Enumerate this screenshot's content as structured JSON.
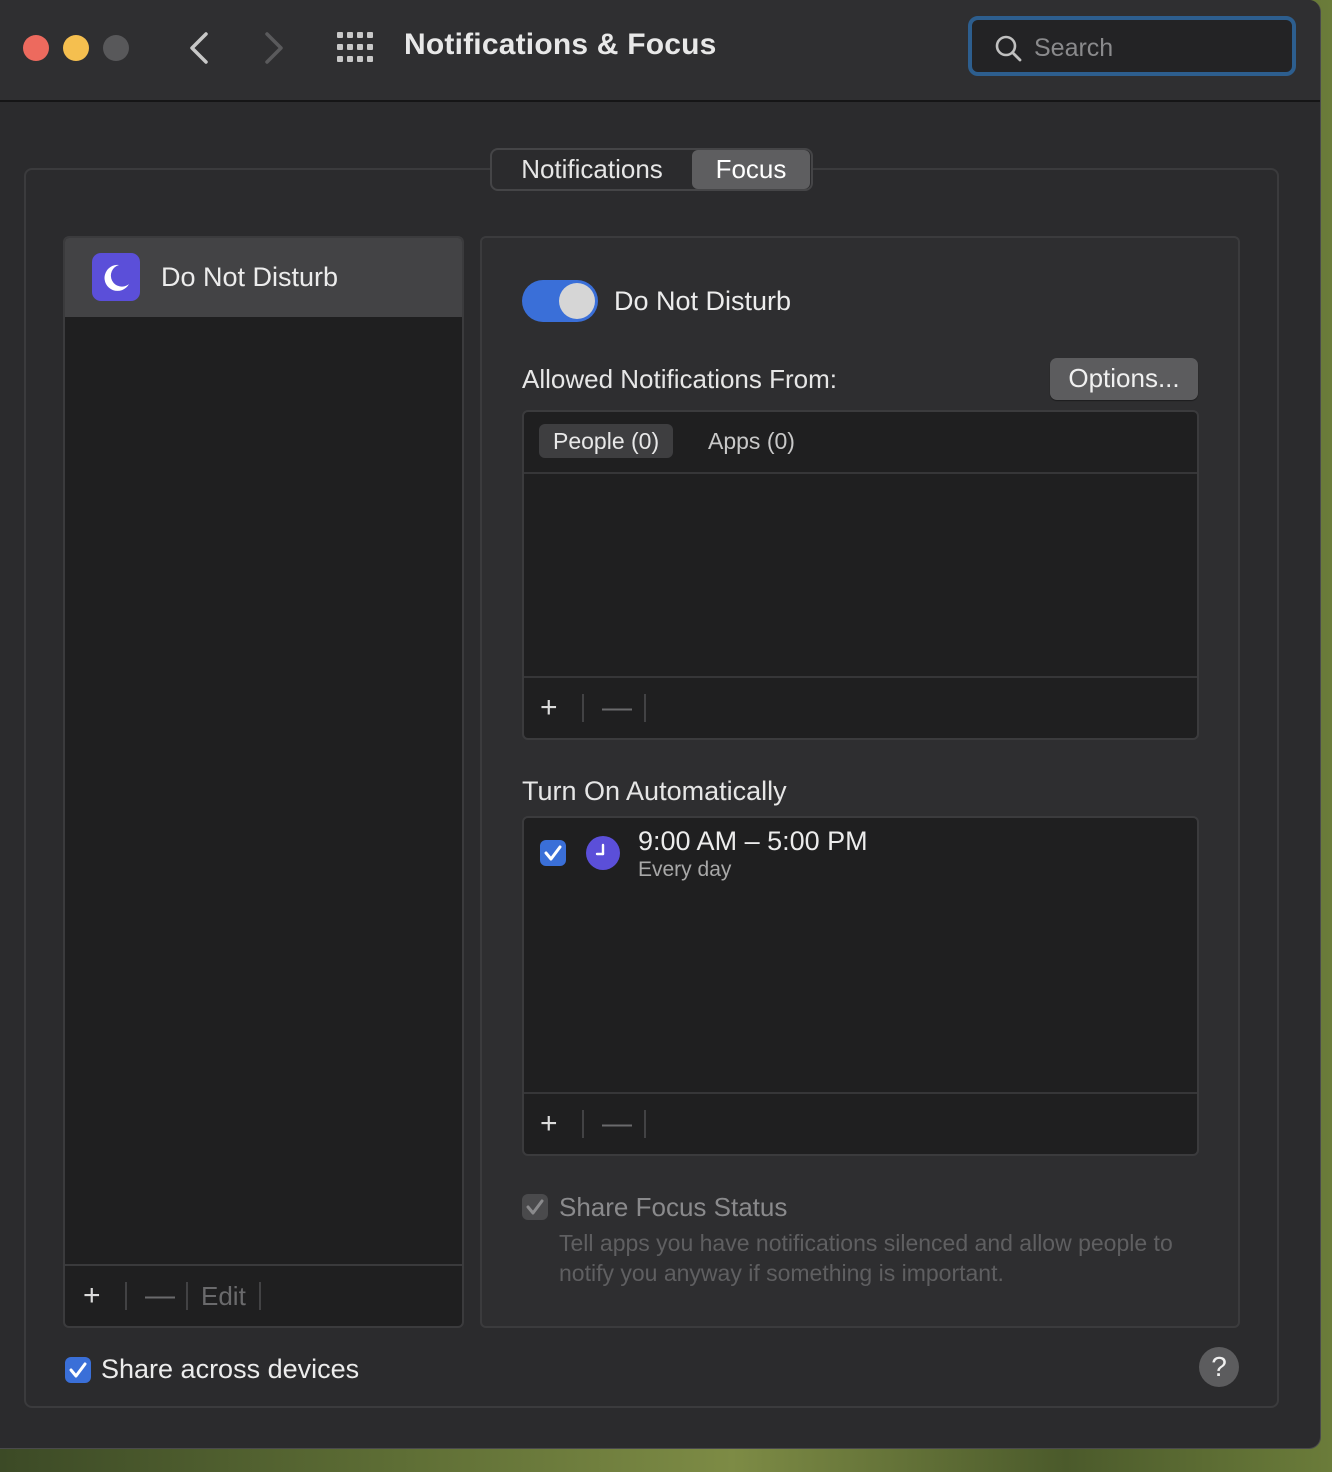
{
  "window": {
    "title": "Notifications & Focus",
    "search_placeholder": "Search"
  },
  "tabs": [
    {
      "label": "Notifications",
      "selected": false
    },
    {
      "label": "Focus",
      "selected": true
    }
  ],
  "focus_list": {
    "items": [
      {
        "label": "Do Not Disturb",
        "icon": "moon-icon",
        "selected": true
      }
    ],
    "footer": {
      "add": "+",
      "remove": "—",
      "edit": "Edit"
    }
  },
  "detail": {
    "toggle_label": "Do Not Disturb",
    "toggle_on": true,
    "allowed_label": "Allowed Notifications From:",
    "options_button": "Options...",
    "allowed_tabs": [
      {
        "label": "People (0)",
        "selected": true
      },
      {
        "label": "Apps (0)",
        "selected": false
      }
    ],
    "list_footer": {
      "add": "+",
      "remove": "—"
    },
    "auto_label": "Turn On Automatically",
    "schedules": [
      {
        "time": "9:00 AM – 5:00 PM",
        "repeat": "Every day",
        "checked": true,
        "icon": "clock-icon"
      }
    ],
    "auto_footer": {
      "add": "+",
      "remove": "—"
    },
    "share_focus": {
      "title": "Share Focus Status",
      "description": "Tell apps you have notifications silenced and allow people to notify you anyway if something is important.",
      "checked": true,
      "disabled": true
    }
  },
  "bottom": {
    "share_devices_label": "Share across devices",
    "share_devices_checked": true,
    "help": "?"
  },
  "colors": {
    "accent": "#3a6fd8",
    "focus_purple": "#5b4fd9",
    "window_bg": "#2b2b2d",
    "list_bg": "#1f1f20"
  }
}
